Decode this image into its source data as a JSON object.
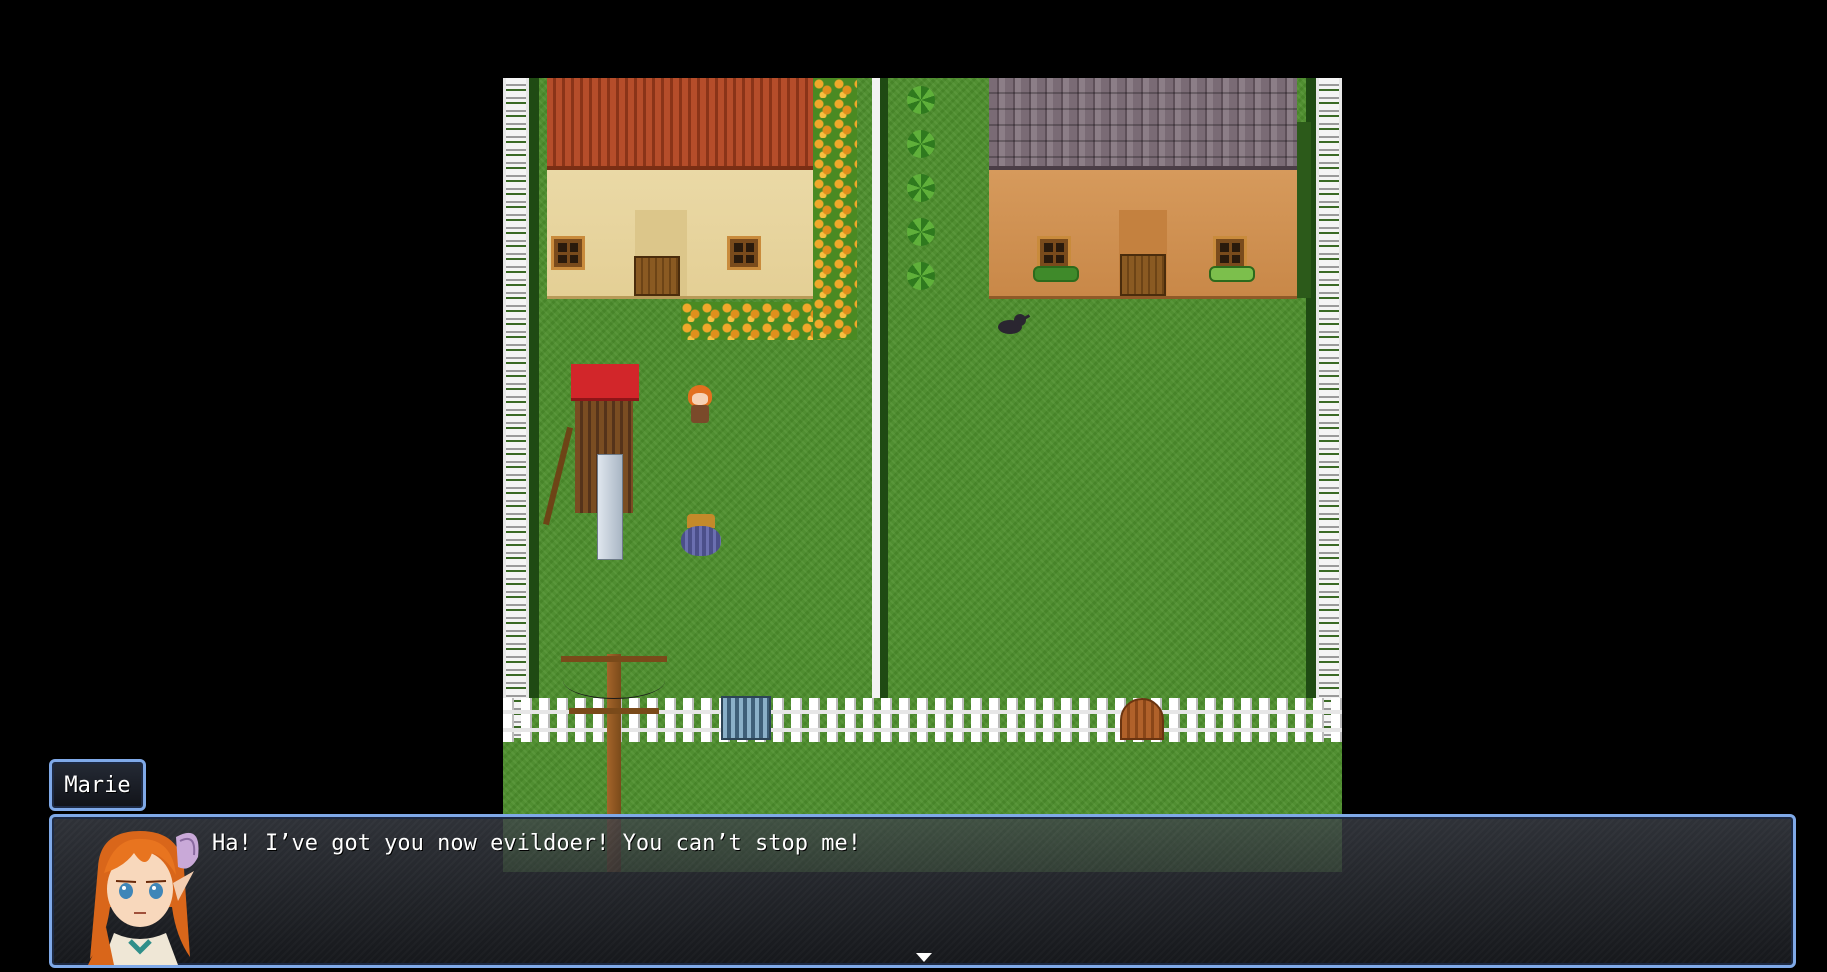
{
  "dialogue": {
    "speaker": "Marie",
    "message": "Ha! I’ve got you now evildoer! You can’t stop me!"
  },
  "icons": {
    "continue": "continue-arrow-icon",
    "portrait": "marie-portrait-icon"
  },
  "colors": {
    "window_border": "#7fa9e8",
    "grass": "#4d8f2c",
    "background": "#000000"
  }
}
